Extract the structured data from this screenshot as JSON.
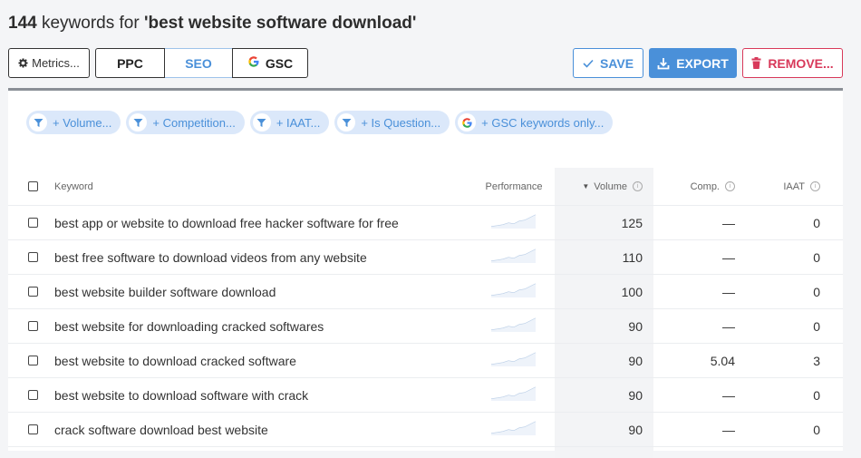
{
  "header": {
    "count": "144",
    "mid_text": " keywords for ",
    "query": "'best website software download'"
  },
  "toolbar": {
    "metrics_label": "Metrics...",
    "tabs": [
      "PPC",
      "SEO",
      "GSC"
    ],
    "active_tab": "SEO",
    "save_label": "SAVE",
    "export_label": "EXPORT",
    "remove_label": "REMOVE..."
  },
  "filters": [
    {
      "label": "+ Volume...",
      "icon": "filter-icon"
    },
    {
      "label": "+ Competition...",
      "icon": "filter-icon"
    },
    {
      "label": "+ IAAT...",
      "icon": "filter-icon"
    },
    {
      "label": "+ Is Question...",
      "icon": "filter-icon"
    },
    {
      "label": "+ GSC keywords only...",
      "icon": "google-icon"
    }
  ],
  "table": {
    "columns": {
      "keyword": "Keyword",
      "performance": "Performance",
      "volume": "Volume",
      "comp": "Comp.",
      "iaat": "IAAT"
    },
    "sort_column": "Volume",
    "rows": [
      {
        "keyword": "best app or website to download free hacker software for free",
        "volume": "125",
        "comp": "—",
        "iaat": "0"
      },
      {
        "keyword": "best free software to download videos from any website",
        "volume": "110",
        "comp": "—",
        "iaat": "0"
      },
      {
        "keyword": "best website builder software download",
        "volume": "100",
        "comp": "—",
        "iaat": "0"
      },
      {
        "keyword": "best website for downloading cracked softwares",
        "volume": "90",
        "comp": "—",
        "iaat": "0"
      },
      {
        "keyword": "best website to download cracked software",
        "volume": "90",
        "comp": "5.04",
        "iaat": "3"
      },
      {
        "keyword": "best website to download software with crack",
        "volume": "90",
        "comp": "—",
        "iaat": "0"
      },
      {
        "keyword": "crack software download best website",
        "volume": "90",
        "comp": "—",
        "iaat": "0"
      }
    ]
  },
  "colors": {
    "accent": "#4a90d9",
    "danger": "#d8395a",
    "chip_bg": "#dbe8fa"
  }
}
